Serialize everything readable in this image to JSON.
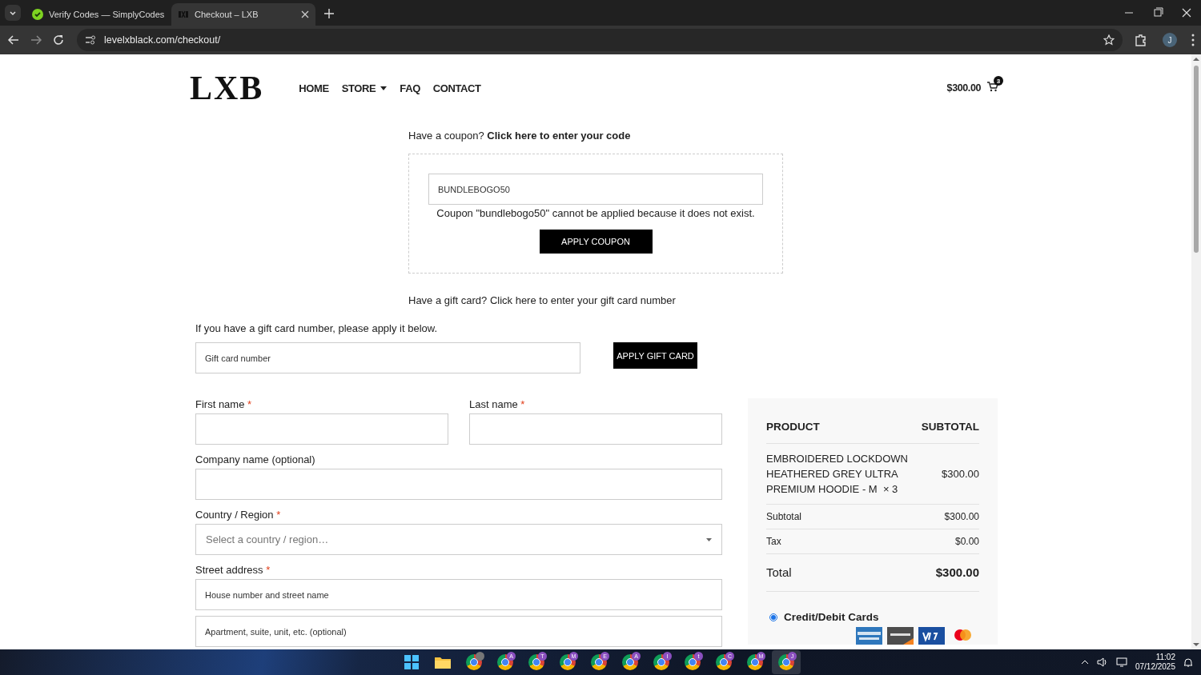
{
  "browser": {
    "tabs": [
      {
        "title": "Verify Codes — SimplyCodes",
        "selected": false,
        "kind": "check"
      },
      {
        "title": "Checkout – LXB",
        "selected": true,
        "kind": "lxb"
      }
    ],
    "url": "levelxblack.com/checkout/",
    "profile_initial": "J"
  },
  "header": {
    "logo": "LXB",
    "nav": [
      {
        "label": "HOME",
        "dropdown": false
      },
      {
        "label": "STORE",
        "dropdown": true
      },
      {
        "label": "FAQ",
        "dropdown": false
      },
      {
        "label": "CONTACT",
        "dropdown": false
      }
    ],
    "cart_total": "$300.00",
    "cart_count": "3"
  },
  "coupon": {
    "prompt": "Have a coupon?",
    "link": "Click here to enter your code",
    "value": "BUNDLEBOGO50",
    "error": "Coupon \"bundlebogo50\" cannot be applied because it does not exist.",
    "button": "APPLY COUPON"
  },
  "gift_card": {
    "prompt": "Have a gift card? Click here to enter your gift card number",
    "instruction": "If you have a gift card number, please apply it below.",
    "placeholder": "Gift card number",
    "button": "APPLY GIFT CARD"
  },
  "billing": {
    "rows": [
      [
        {
          "label": "First name",
          "required_mark": "*",
          "kind": "text"
        },
        {
          "label": "Last name",
          "required_mark": "*",
          "kind": "text"
        }
      ],
      [
        {
          "label": "Company name (optional)",
          "kind": "text"
        }
      ],
      [
        {
          "label": "Country / Region",
          "required_mark": "*",
          "kind": "select",
          "placeholder": "Select a country / region…"
        }
      ],
      [
        {
          "label": "Street address",
          "required_mark": "*",
          "kind": "text",
          "placeholder": "House number and street name"
        }
      ],
      [
        {
          "kind": "text",
          "placeholder": "Apartment, suite, unit, etc. (optional)"
        }
      ]
    ]
  },
  "order": {
    "headers": [
      "PRODUCT",
      "SUBTOTAL"
    ],
    "items": [
      {
        "name": "EMBROIDERED LOCKDOWN HEATHERED GREY ULTRA PREMIUM HOODIE - M",
        "quantity": "× 3",
        "total": "$300.00"
      }
    ],
    "totals": [
      {
        "label": "Subtotal",
        "value": "$300.00",
        "kind": "normal"
      },
      {
        "label": "Tax",
        "value": "$0.00",
        "kind": "normal"
      },
      {
        "label": "Total",
        "value": "$300.00",
        "kind": "grand"
      }
    ],
    "payment": [
      {
        "label": "Credit/Debit Cards",
        "selected": true
      }
    ]
  },
  "taskbar": {
    "apps": [
      {
        "kind": "start",
        "selected": false
      },
      {
        "kind": "files",
        "selected": false
      },
      {
        "kind": "chrome_avatar",
        "selected": false
      },
      {
        "kind": "chrome",
        "badge": "A",
        "selected": false
      },
      {
        "kind": "chrome",
        "badge": "T",
        "selected": false
      },
      {
        "kind": "chrome",
        "badge": "M",
        "selected": false
      },
      {
        "kind": "chrome",
        "badge": "E",
        "selected": false
      },
      {
        "kind": "chrome",
        "badge": "A",
        "selected": false
      },
      {
        "kind": "chrome",
        "badge": "I",
        "selected": false
      },
      {
        "kind": "chrome",
        "badge": "t",
        "selected": false
      },
      {
        "kind": "chrome",
        "badge": "C",
        "selected": false
      },
      {
        "kind": "chrome",
        "badge": "M",
        "selected": false
      },
      {
        "kind": "chrome",
        "badge": "J",
        "selected": true
      }
    ],
    "time": "11:02",
    "date": "07/12/2025"
  }
}
